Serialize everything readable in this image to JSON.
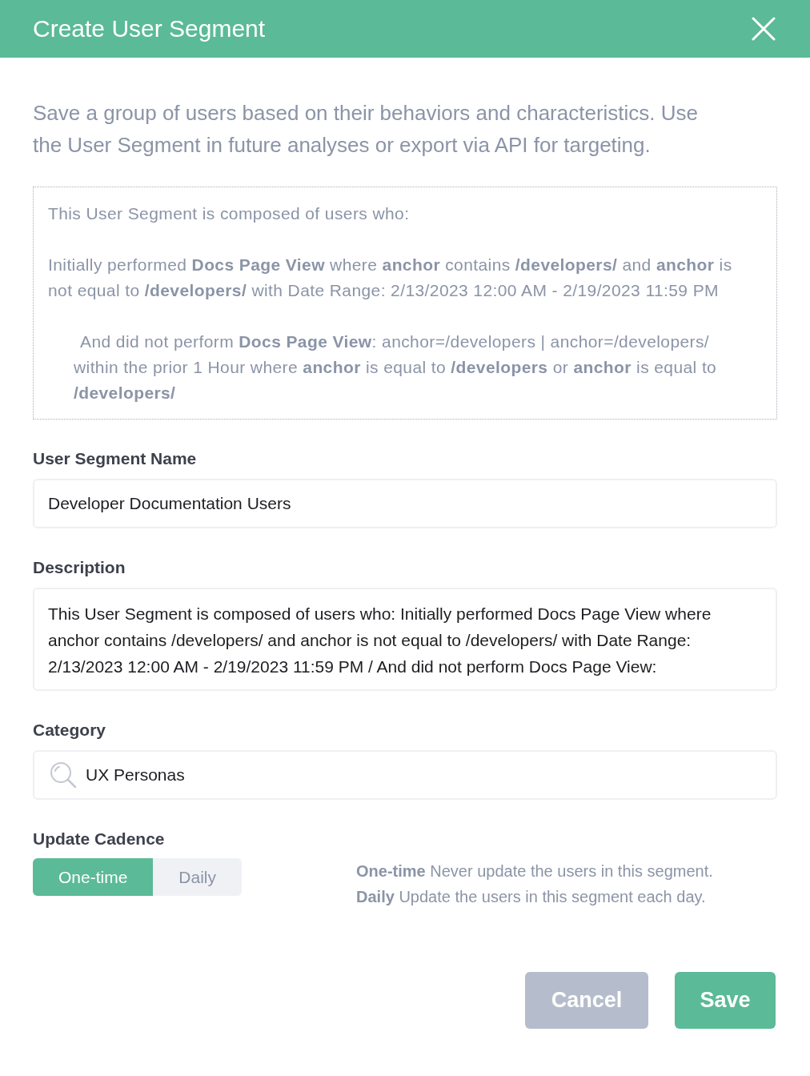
{
  "dialog": {
    "title": "Create User Segment"
  },
  "intro": "Save a group of users based on their behaviors and characteristics. Use the User Segment in future analyses or export via API for targeting.",
  "summary": {
    "paragraphs": [
      {
        "text": "This User Segment is composed of users who:"
      },
      {
        "text": "Initially performed **Docs Page View** where **anchor** contains **/developers/** and **anchor** is not equal to **/developers/** with Date Range: 2/13/2023 12:00 AM - 2/19/2023 11:59 PM",
        "children": [
          {
            "text": "And did not perform **Docs Page View**: anchor=/developers | anchor=/developers/ within the prior 1 Hour where **anchor** is equal to **/developers** or **anchor** is equal to **/developers/**"
          }
        ]
      }
    ]
  },
  "fields": [
    {
      "kind": "text",
      "label": "User Segment Name",
      "value": "Developer Documentation Users"
    },
    {
      "kind": "textarea",
      "label": "Description",
      "value": "This User Segment is composed of users who: Initially performed Docs Page View where anchor contains /developers/ and anchor is not equal to /developers/ with Date Range: 2/13/2023 12:00 AM - 2/19/2023 11:59 PM / And did not perform Docs Page View:"
    },
    {
      "kind": "search",
      "label": "Category",
      "value": "UX Personas"
    }
  ],
  "cadence": {
    "label": "Update Cadence",
    "options": [
      {
        "label": "One-time",
        "selected": true
      },
      {
        "label": "Daily",
        "selected": false
      }
    ],
    "help": [
      "**One-time** Never update the users in this segment.",
      "**Daily** Update the users in this segment each day."
    ]
  },
  "buttons": [
    {
      "kind": "secondary",
      "label": "Cancel"
    },
    {
      "kind": "primary",
      "label": "Save"
    }
  ]
}
